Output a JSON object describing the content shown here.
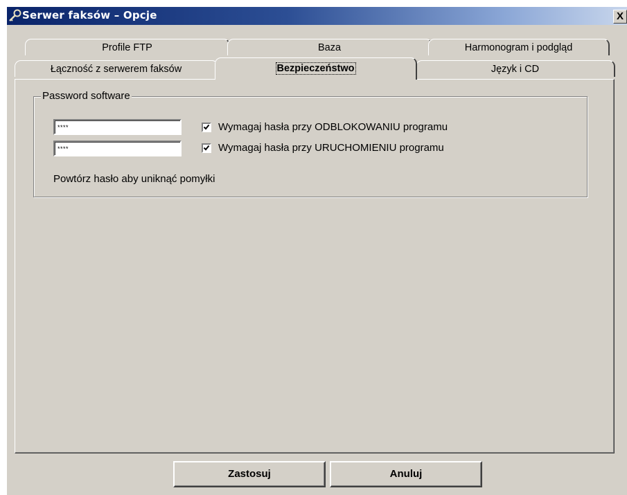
{
  "window": {
    "title": "Serwer faksów – Opcje",
    "close_label": "X"
  },
  "tabs": {
    "row_back": [
      "Profile FTP",
      "Baza",
      "Harmonogram i podgląd"
    ],
    "row_front": [
      "Łączność z serwerem faksów",
      "Bezpieczeństwo",
      "Język i CD"
    ],
    "active": "Bezpieczeństwo"
  },
  "security": {
    "group_label": "Password software",
    "password1_value": "****",
    "password2_value": "****",
    "checkbox1": {
      "label": "Wymagaj hasła przy ODBLOKOWANIU programu",
      "checked": true
    },
    "checkbox2": {
      "label": "Wymagaj hasła przy URUCHOMIENIU programu",
      "checked": true
    },
    "hint": "Powtórz hasło aby uniknąć pomyłki"
  },
  "buttons": {
    "apply": "Zastosuj",
    "cancel": "Anuluj"
  }
}
